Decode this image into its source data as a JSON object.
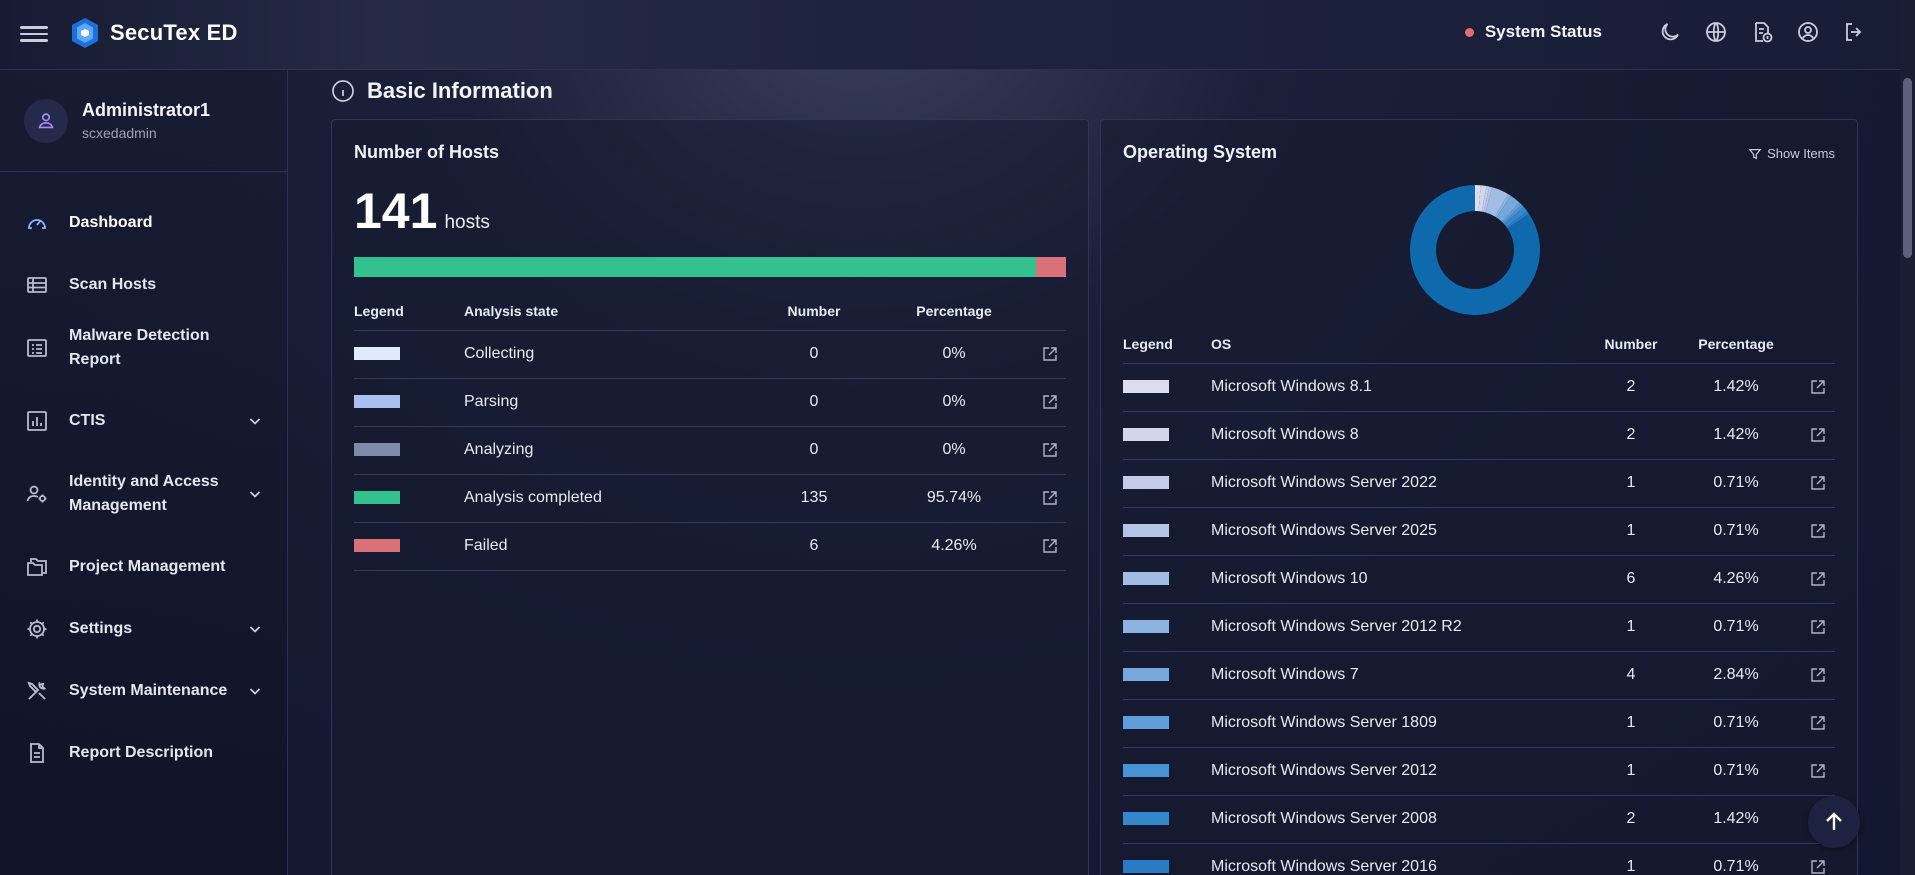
{
  "app": {
    "title": "SecuTex ED"
  },
  "topbar": {
    "status_label": "System Status",
    "status_color": "#e36a73",
    "icons": [
      "theme-moon-icon",
      "language-globe-icon",
      "document-info-icon",
      "account-circle-icon",
      "logout-icon"
    ]
  },
  "user": {
    "name": "Administrator1",
    "username": "scxedadmin"
  },
  "sidebar": {
    "items": [
      {
        "label": "Dashboard",
        "icon": "dashboard-gauge-icon",
        "expandable": false,
        "active": true
      },
      {
        "label": "Scan Hosts",
        "icon": "list-table-icon",
        "expandable": false
      },
      {
        "label": "Malware Detection Report",
        "icon": "report-list-icon",
        "expandable": false
      },
      {
        "label": "CTIS",
        "icon": "bar-chart-icon",
        "expandable": true
      },
      {
        "label": "Identity and Access Management",
        "icon": "user-gear-icon",
        "expandable": true
      },
      {
        "label": "Project Management",
        "icon": "folders-icon",
        "expandable": false
      },
      {
        "label": "Settings",
        "icon": "gear-icon",
        "expandable": true
      },
      {
        "label": "System Maintenance",
        "icon": "tools-icon",
        "expandable": true
      },
      {
        "label": "Report Description",
        "icon": "document-icon",
        "expandable": false
      }
    ]
  },
  "main": {
    "section_title": "Basic Information",
    "hosts": {
      "title": "Number of Hosts",
      "count": "141",
      "unit": "hosts",
      "headers": {
        "legend": "Legend",
        "state": "Analysis state",
        "number": "Number",
        "percentage": "Percentage"
      },
      "rows": [
        {
          "state": "Collecting",
          "number": "0",
          "percentage": "0%",
          "color": "#dfe9ff",
          "value": 0
        },
        {
          "state": "Parsing",
          "number": "0",
          "percentage": "0%",
          "color": "#a9c0f0",
          "value": 0
        },
        {
          "state": "Analyzing",
          "number": "0",
          "percentage": "0%",
          "color": "#7d8aa9",
          "value": 0
        },
        {
          "state": "Analysis completed",
          "number": "135",
          "percentage": "95.74%",
          "color": "#33c28e",
          "value": 135
        },
        {
          "state": "Failed",
          "number": "6",
          "percentage": "4.26%",
          "color": "#d87178",
          "value": 6
        }
      ]
    },
    "os": {
      "title": "Operating System",
      "show_items_label": "Show Items",
      "headers": {
        "legend": "Legend",
        "os": "OS",
        "number": "Number",
        "percentage": "Percentage"
      },
      "rows": [
        {
          "os": "Microsoft Windows 8.1",
          "number": "2",
          "percentage": "1.42%",
          "color": "#dcdcee",
          "value": 2
        },
        {
          "os": "Microsoft Windows 8",
          "number": "2",
          "percentage": "1.42%",
          "color": "#d1d6ec",
          "value": 2
        },
        {
          "os": "Microsoft Windows Server 2022",
          "number": "1",
          "percentage": "0.71%",
          "color": "#c3cbe8",
          "value": 1
        },
        {
          "os": "Microsoft Windows Server 2025",
          "number": "1",
          "percentage": "0.71%",
          "color": "#b3c4e6",
          "value": 1
        },
        {
          "os": "Microsoft Windows 10",
          "number": "6",
          "percentage": "4.26%",
          "color": "#a1bde4",
          "value": 6
        },
        {
          "os": "Microsoft Windows Server 2012 R2",
          "number": "1",
          "percentage": "0.71%",
          "color": "#8db4e0",
          "value": 1
        },
        {
          "os": "Microsoft Windows 7",
          "number": "4",
          "percentage": "2.84%",
          "color": "#76a8dc",
          "value": 4
        },
        {
          "os": "Microsoft Windows Server 1809",
          "number": "1",
          "percentage": "0.71%",
          "color": "#5f9ed8",
          "value": 1
        },
        {
          "os": "Microsoft Windows Server 2012",
          "number": "1",
          "percentage": "0.71%",
          "color": "#4793d3",
          "value": 1
        },
        {
          "os": "Microsoft Windows Server 2008",
          "number": "2",
          "percentage": "1.42%",
          "color": "#3587cc",
          "value": 2
        },
        {
          "os": "Microsoft Windows Server 2016",
          "number": "1",
          "percentage": "0.71%",
          "color": "#2a7bc3",
          "value": 1
        }
      ],
      "donut_remaining_color": "#0e6aad",
      "donut_remaining_value": 119
    }
  }
}
